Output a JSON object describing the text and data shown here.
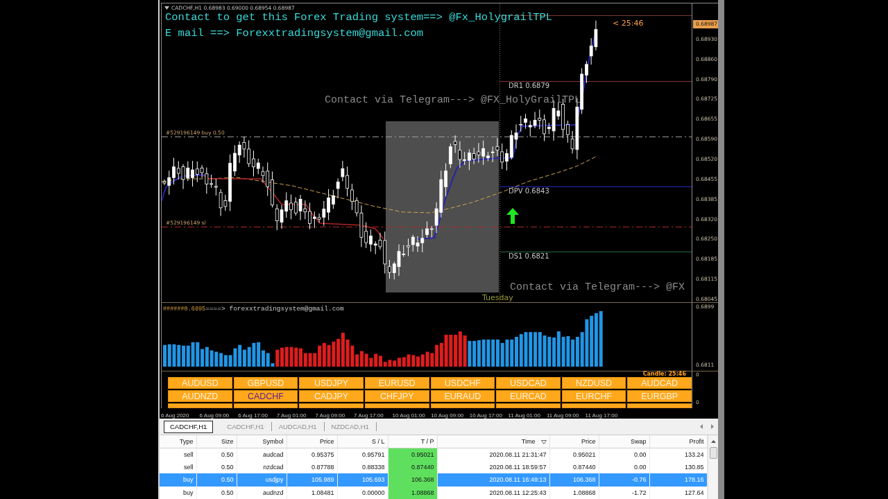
{
  "chart_window": {
    "title": "CADCHF,H1 0.68983 0.69000 0.68954 0.68987",
    "notes": [
      "Contact to get this Forex Trading system==> @Fx_HolygrailTPL",
      "E mail ==> Forexxtradingsystem@gmail.com"
    ],
    "timer": "< 25:46",
    "watermarks": [
      "Contact via Telegram---> @FX_HolyGrailTPL",
      "Contact via Telegram---> @FX"
    ],
    "order_lines": [
      {
        "kind": "entry",
        "label": "#529196149 buy 0.50"
      },
      {
        "kind": "stop",
        "label": "#529196149 sl"
      }
    ],
    "pivot_levels": [
      {
        "kind": "resistance",
        "label": "DR1 0.6879"
      },
      {
        "kind": "pivot",
        "label": "DPV 0.6843"
      },
      {
        "kind": "support",
        "label": "DS1 0.6821"
      }
    ],
    "session_label": "Tuesday",
    "price_axis": {
      "current": "0.68987",
      "ticks": [
        "0.68930",
        "0.68860",
        "0.68790",
        "0.68725",
        "0.68655",
        "0.68590",
        "0.68520",
        "0.68455",
        "0.68385",
        "0.68320",
        "0.68250",
        "0.68185",
        "0.68115",
        "0.68045"
      ]
    },
    "indicator": {
      "tag": "######0.6895",
      "label": "====> forexxtradingsystem@gmail.com",
      "axis_labels": [
        "0.6899",
        "0.6811"
      ]
    },
    "currency_panel": {
      "candle_timer": "Candle: 25:46",
      "axis_labels": [
        "0",
        "0"
      ],
      "buttons": [
        {
          "kind": "full",
          "label": "AUDUSD",
          "selected": false
        },
        {
          "kind": "full",
          "label": "GBPUSD",
          "selected": false
        },
        {
          "kind": "full",
          "label": "USDJPY",
          "selected": false
        },
        {
          "kind": "full",
          "label": "EURUSD",
          "selected": false
        },
        {
          "kind": "full",
          "label": "USDCHF",
          "selected": false
        },
        {
          "kind": "full",
          "label": "USDCAD",
          "selected": false
        },
        {
          "kind": "full",
          "label": "NZDUSD",
          "selected": false
        },
        {
          "kind": "full",
          "label": "AUDCAD",
          "selected": false
        },
        {
          "kind": "full",
          "label": "AUDNZD",
          "selected": false
        },
        {
          "kind": "full",
          "label": "CADCHF",
          "selected": true
        },
        {
          "kind": "full",
          "label": "CADJPY",
          "selected": false
        },
        {
          "kind": "full",
          "label": "CHFJPY",
          "selected": false
        },
        {
          "kind": "full",
          "label": "EURAUD",
          "selected": false
        },
        {
          "kind": "full",
          "label": "EURCAD",
          "selected": false
        },
        {
          "kind": "full",
          "label": "EURCHF",
          "selected": false
        },
        {
          "kind": "full",
          "label": "EURGBP",
          "selected": false
        },
        {
          "kind": "clipped"
        },
        {
          "kind": "clipped"
        },
        {
          "kind": "clipped"
        },
        {
          "kind": "clipped"
        },
        {
          "kind": "clipped"
        },
        {
          "kind": "clipped"
        },
        {
          "kind": "clipped"
        },
        {
          "kind": "clipped"
        }
      ]
    },
    "time_axis": [
      "6 Aug 2020",
      "6 Aug 09:00",
      "6 Aug 17:00",
      "7 Aug 01:00",
      "7 Aug 09:00",
      "7 Aug 17:00",
      "10 Aug 01:00",
      "10 Aug 09:00",
      "10 Aug 17:00",
      "11 Aug 01:00",
      "11 Aug 09:00",
      "11 Aug 17:00"
    ]
  },
  "terminal": {
    "tabs": [
      {
        "label": "CADCHF,H1",
        "selected": true
      },
      {
        "label": "CADCHF,H1",
        "selected": false
      },
      {
        "label": "AUDCAD,H1",
        "selected": false
      },
      {
        "label": "NZDCAD,H1",
        "selected": false
      }
    ],
    "table": {
      "columns": [
        {
          "label": "Type",
          "sorted": false
        },
        {
          "label": "Size",
          "sorted": false
        },
        {
          "label": "Symbol",
          "sorted": false
        },
        {
          "label": "Price",
          "sorted": false
        },
        {
          "label": "S / L",
          "sorted": false
        },
        {
          "label": "T / P",
          "sorted": false
        },
        {
          "label": "Time",
          "sorted": true
        },
        {
          "label": "Price",
          "sorted": false
        },
        {
          "label": "Swap",
          "sorted": false
        },
        {
          "label": "Profit",
          "sorted": false
        }
      ],
      "rows": [
        {
          "cells": [
            "sell",
            "0.50",
            "audcad",
            "0.95375",
            "0.95791",
            "0.95021",
            "2020.08.11 21:31:47",
            "0.95021",
            "0.00",
            "133.24"
          ],
          "selected": false,
          "tp_hit": true
        },
        {
          "cells": [
            "sell",
            "0.50",
            "nzdcad",
            "0.87788",
            "0.88338",
            "0.87440",
            "2020.08.11 18:59:57",
            "0.87440",
            "0.00",
            "130.85"
          ],
          "selected": false,
          "tp_hit": true
        },
        {
          "cells": [
            "buy",
            "0.50",
            "usdjpy",
            "105.989",
            "105.693",
            "106.368",
            "2020.08.11 16:49:13",
            "106.368",
            "-0.76",
            "178.16"
          ],
          "selected": true,
          "tp_hit": true
        },
        {
          "cells": [
            "buy",
            "0.50",
            "audnzd",
            "1.08481",
            "0.00000",
            "1.08868",
            "2020.08.11 12:25:43",
            "1.08868",
            "-1.72",
            "127.64"
          ],
          "selected": false,
          "tp_hit": true
        }
      ]
    }
  }
}
